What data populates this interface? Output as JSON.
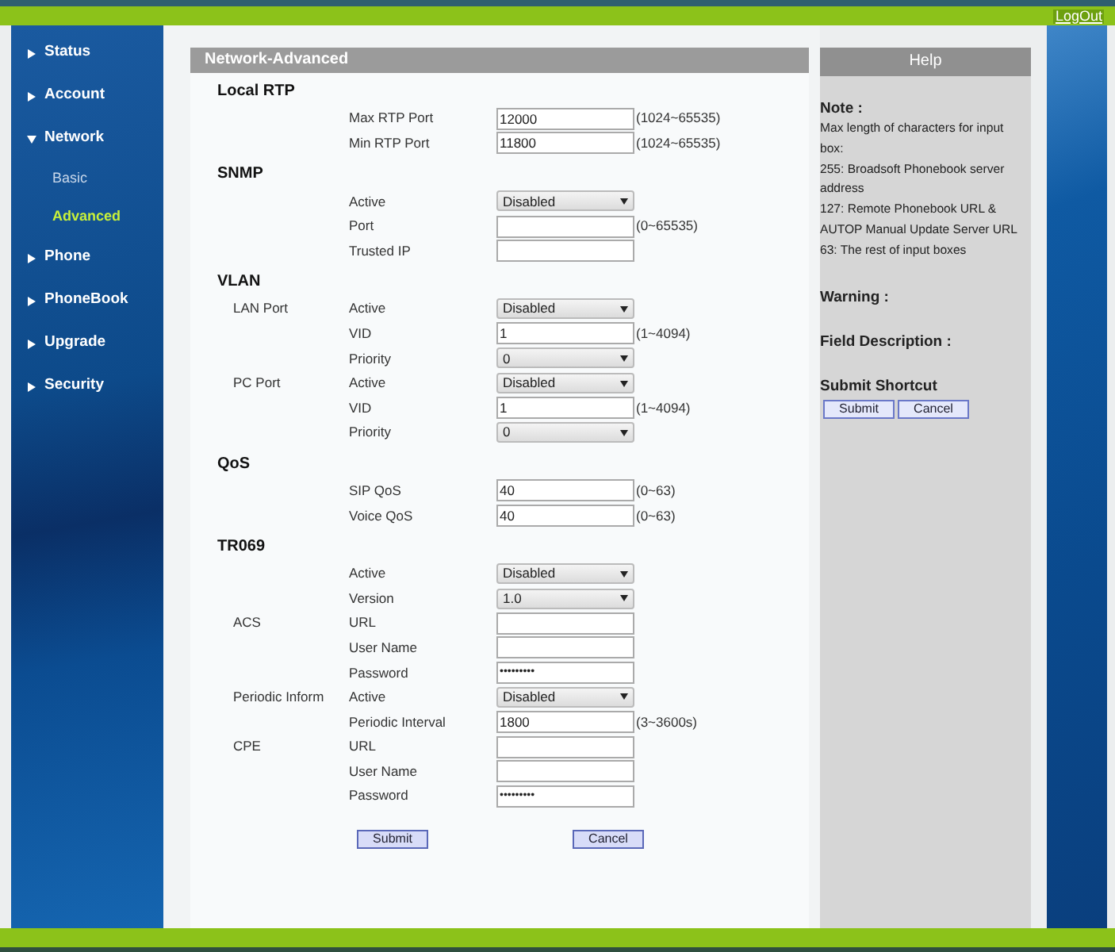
{
  "top_bar": {
    "logout_link": "LogOut"
  },
  "sidebar": {
    "items": [
      {
        "label": "Status",
        "expanded": false
      },
      {
        "label": "Account",
        "expanded": false
      },
      {
        "label": "Network",
        "expanded": true,
        "children": [
          {
            "label": "Basic",
            "selected": false
          },
          {
            "label": "Advanced",
            "selected": true
          }
        ]
      },
      {
        "label": "Phone",
        "expanded": false
      },
      {
        "label": "PhoneBook",
        "expanded": false
      },
      {
        "label": "Upgrade",
        "expanded": false
      },
      {
        "label": "Security",
        "expanded": false
      }
    ]
  },
  "panel": {
    "title": "Network-Advanced",
    "rows": [
      {
        "kind": "heading",
        "label": "Local RTP"
      },
      {
        "kind": "input",
        "label": "Max RTP Port",
        "value": "12000",
        "hint": "(1024~65535)"
      },
      {
        "kind": "input",
        "label": "Min RTP Port",
        "value": "11800",
        "hint": "(1024~65535)"
      },
      {
        "kind": "heading",
        "label": "SNMP"
      },
      {
        "kind": "select",
        "label": "Active",
        "value": "Disabled"
      },
      {
        "kind": "input",
        "label": "Port",
        "hint": "(0~65535)"
      },
      {
        "kind": "input",
        "label": "Trusted IP"
      },
      {
        "kind": "heading",
        "label": "VLAN"
      },
      {
        "kind": "select",
        "group": "LAN Port",
        "label": "Active",
        "value": "Disabled"
      },
      {
        "kind": "input",
        "label": "VID",
        "value": "1",
        "hint": "(1~4094)"
      },
      {
        "kind": "select",
        "label": "Priority",
        "value": "0"
      },
      {
        "kind": "select",
        "group": "PC Port",
        "label": "Active",
        "value": "Disabled"
      },
      {
        "kind": "input",
        "label": "VID",
        "value": "1",
        "hint": "(1~4094)"
      },
      {
        "kind": "select",
        "label": "Priority",
        "value": "0"
      },
      {
        "kind": "heading",
        "label": "QoS"
      },
      {
        "kind": "input",
        "label": "SIP QoS",
        "value": "40",
        "hint": "(0~63)"
      },
      {
        "kind": "input",
        "label": "Voice QoS",
        "value": "40",
        "hint": "(0~63)"
      },
      {
        "kind": "heading",
        "label": "TR069"
      },
      {
        "kind": "select",
        "label": "Active",
        "value": "Disabled"
      },
      {
        "kind": "select",
        "label": "Version",
        "value": "1.0"
      },
      {
        "kind": "input",
        "group": "ACS",
        "label": "URL"
      },
      {
        "kind": "input",
        "label": "User Name"
      },
      {
        "kind": "password",
        "label": "Password",
        "value": "•••••••••"
      },
      {
        "kind": "select",
        "group": "Periodic Inform",
        "label": "Active",
        "value": "Disabled"
      },
      {
        "kind": "input",
        "label": "Periodic Interval",
        "value": "1800",
        "hint": "(3~3600s)"
      },
      {
        "kind": "input",
        "group": "CPE",
        "label": "URL"
      },
      {
        "kind": "input",
        "label": "User Name"
      },
      {
        "kind": "password",
        "label": "Password",
        "value": "•••••••••"
      }
    ],
    "buttons": [
      "Submit",
      "Cancel"
    ]
  },
  "help": {
    "title": "Help",
    "note_heading": "Note :",
    "note_lines": [
      "Max length of characters for input box:",
      "255: Broadsoft Phonebook server address",
      "127: Remote Phonebook URL & AUTOP Manual Update Server URL",
      "63: The rest of input boxes"
    ],
    "warning_heading": "Warning :",
    "field_description_heading": "Field Description :",
    "shortcut_heading": "Submit Shortcut",
    "shortcut_buttons": [
      "Submit",
      "Cancel"
    ]
  }
}
